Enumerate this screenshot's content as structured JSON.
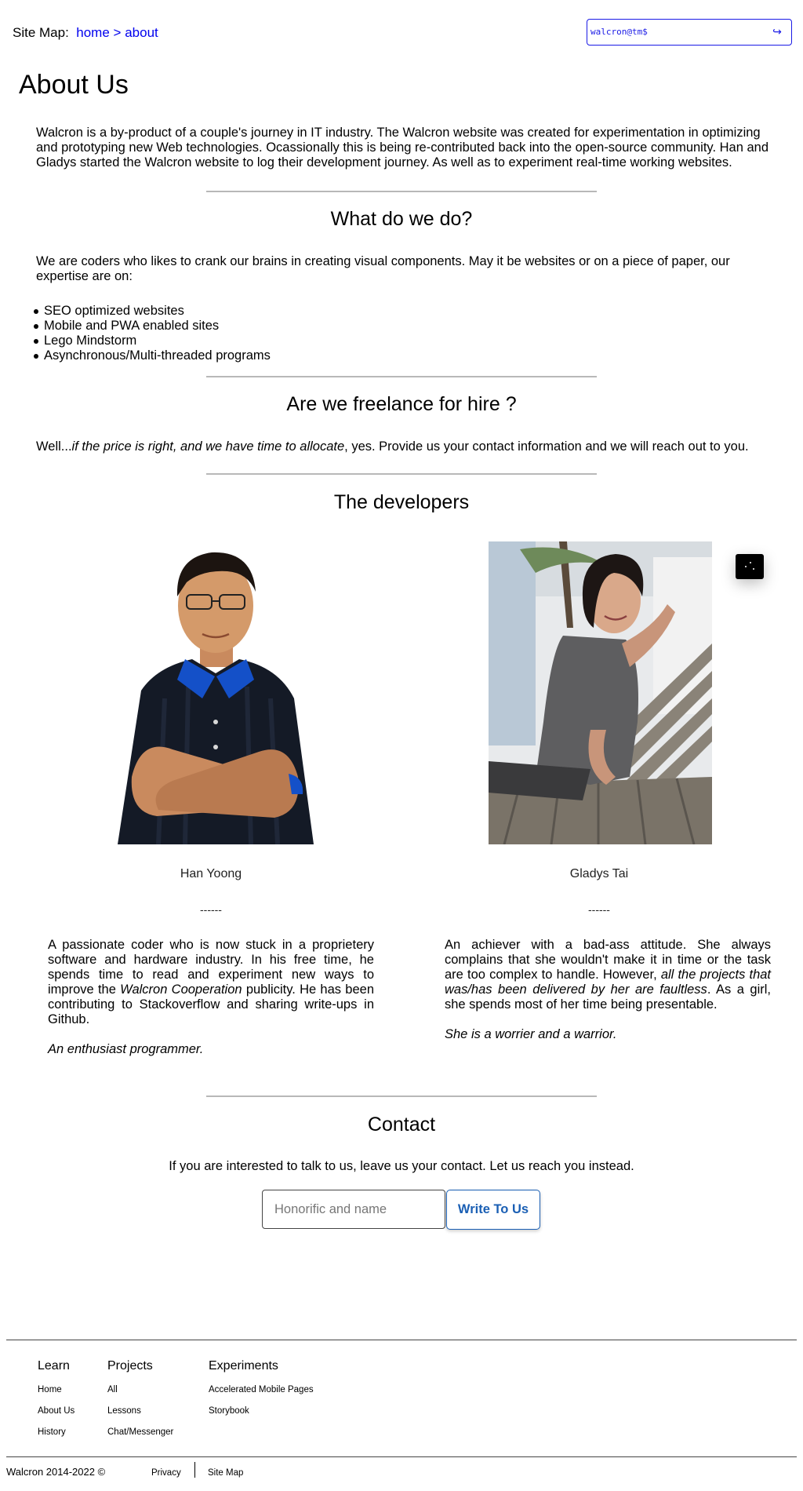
{
  "header": {
    "sitemap_label": "Site Map:",
    "breadcrumb_home": "home",
    "breadcrumb_sep": ">",
    "breadcrumb_current": "about",
    "terminal_value": "walcron@tm$",
    "enter_icon": "enter-arrow-icon"
  },
  "main": {
    "title": "About Us",
    "intro": "Walcron is a by-product of a couple's journey in IT industry. The Walcron website was created for experimentation in optimizing and prototyping new Web technologies. Ocassionally this is being re-contributed back into the open-source community. Han and Gladys started the Walcron website to log their development journey. As well as to experiment real-time working websites.",
    "what_title": "What do we do?",
    "what_text": "We are coders who likes to crank our brains in creating visual components. May it be websites or on a piece of paper, our expertise are on:",
    "expertise": [
      "SEO optimized websites",
      "Mobile and PWA enabled sites",
      "Lego Mindstorm",
      "Asynchronous/Multi-threaded programs"
    ],
    "freelance_title": "Are we freelance for hire ?",
    "freelance_lead": "Well...",
    "freelance_italic": "if the price is right, and we have time to allocate",
    "freelance_rest": ", yes. Provide us your contact information and we will reach out to you.",
    "developers_title": "The developers"
  },
  "developers": [
    {
      "name": "Han Yoong",
      "separator": "------",
      "bio_1": "A passionate coder who is now stuck in a proprietery software and hardware industry. In his free time, he spends time to read and experiment new ways to improve the ",
      "bio_italic": "Walcron Cooperation",
      "bio_2": " publicity. He has been contributing to Stackoverflow and sharing write-ups in Github.",
      "tagline": "An enthusiast programmer."
    },
    {
      "name": "Gladys Tai",
      "separator": "------",
      "bio_1": "An achiever with a bad-ass attitude. She always complains that she wouldn't make it in time or the task are too complex to handle. However, ",
      "bio_italic": "all the projects that was/has been delivered by her are faultless",
      "bio_2": ". As a girl, she spends most of her time being presentable.",
      "tagline": "She is a worrier and a warrior."
    }
  ],
  "contact": {
    "title": "Contact",
    "text": "If you are interested to talk to us, leave us your contact. Let us reach you instead.",
    "placeholder": "Honorific and name",
    "button": "Write To Us"
  },
  "footer": {
    "columns": [
      {
        "title": "Learn",
        "links": [
          "Home",
          "About Us",
          "History"
        ]
      },
      {
        "title": "Projects",
        "links": [
          "All",
          "Lessons",
          "Chat/Messenger"
        ]
      },
      {
        "title": "Experiments",
        "links": [
          "Accelerated Mobile Pages",
          "Storybook"
        ]
      }
    ],
    "copyright": "Walcron 2014-2022 ©",
    "privacy": "Privacy",
    "sitemap": "Site Map"
  },
  "colors": {
    "link_blue": "#0000ee",
    "accent_blue": "#1a5fb4",
    "divider_grey": "#b8b8b8"
  }
}
